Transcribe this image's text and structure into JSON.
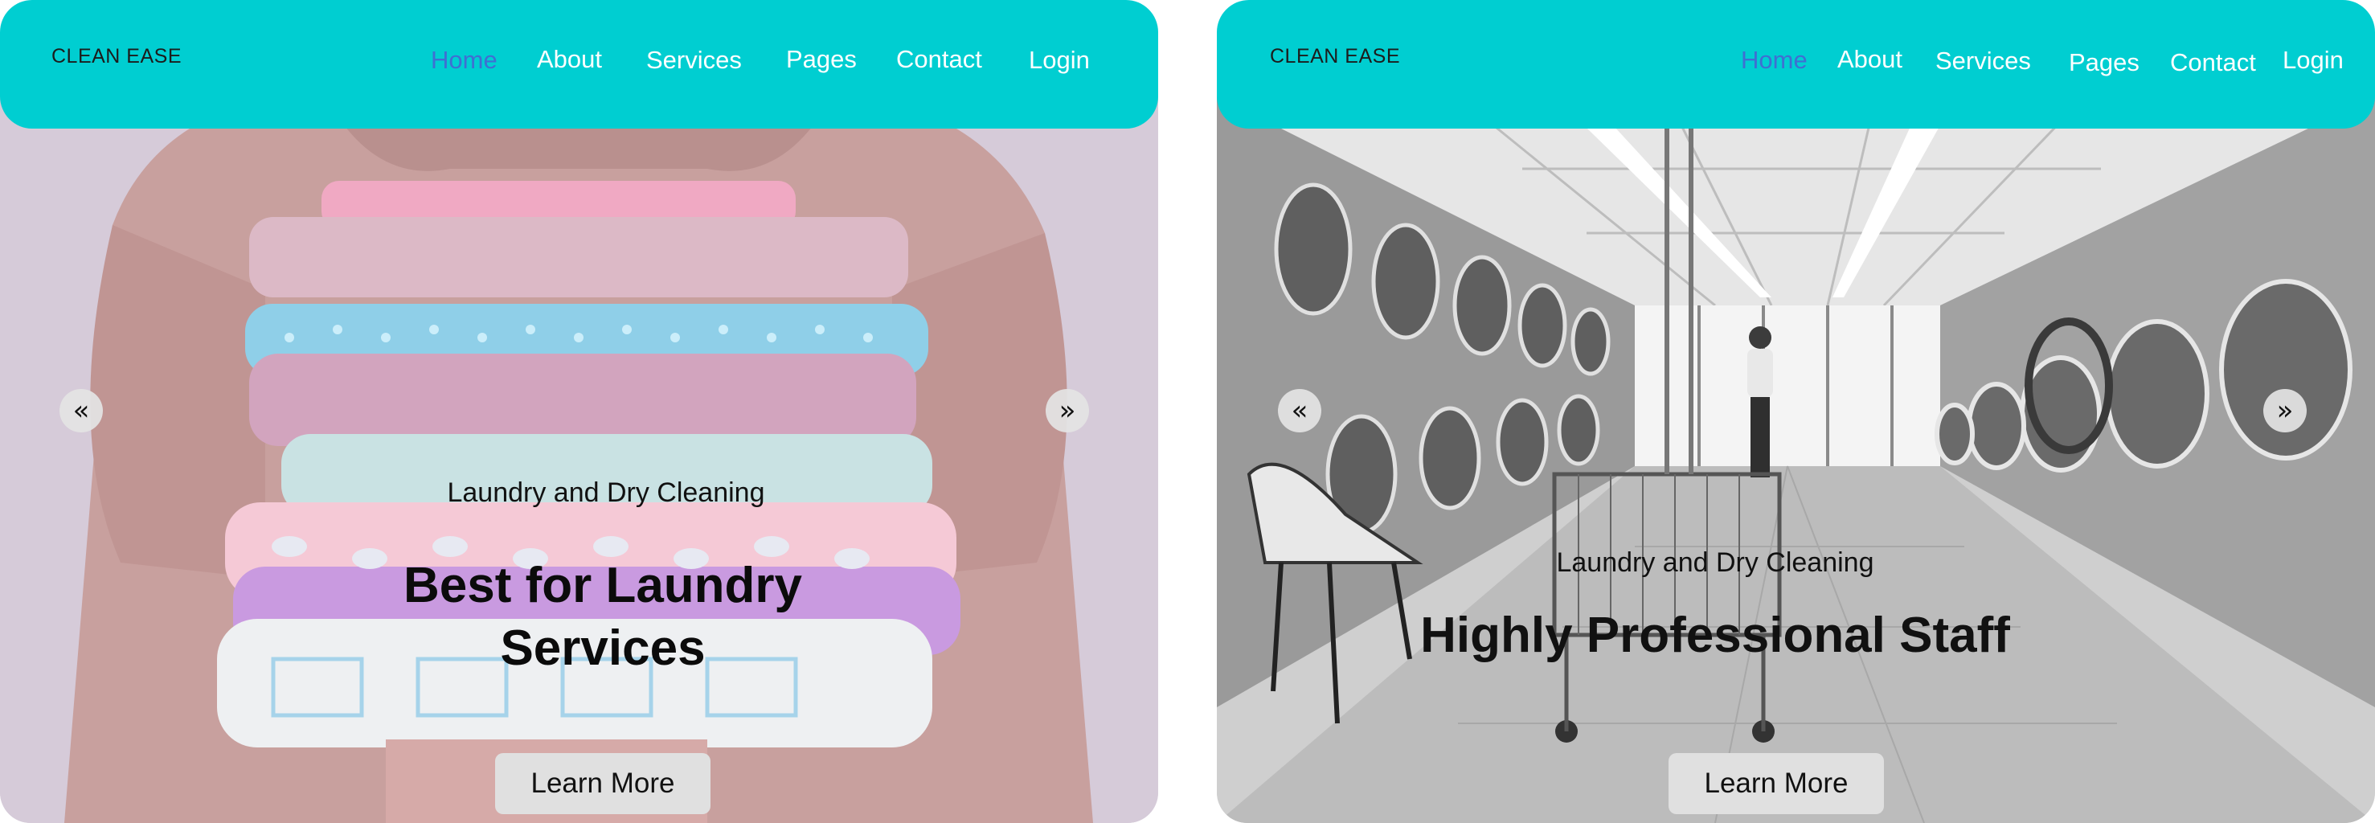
{
  "slides": [
    {
      "brand": "CLEAN EASE",
      "nav": [
        "Home",
        "About",
        "Services",
        "Pages",
        "Contact",
        "Login"
      ],
      "active_nav": "Home",
      "subtitle": "Laundry and Dry Cleaning",
      "title": "Best for Laundry Services",
      "cta": "Learn More",
      "prev_icon": "«",
      "next_icon": "»",
      "photo": "person-holding-stack-of-folded-laundry"
    },
    {
      "brand": "CLEAN EASE",
      "nav": [
        "Home",
        "About",
        "Services",
        "Pages",
        "Contact",
        "Login"
      ],
      "active_nav": "Home",
      "subtitle": "Laundry and Dry Cleaning",
      "title": "Highly Professional Staff",
      "cta": "Learn More",
      "prev_icon": "«",
      "next_icon": "»",
      "photo": "laundromat-interior-black-and-white"
    }
  ],
  "colors": {
    "navbar": "#00ced1",
    "nav_text": "#ffffff",
    "nav_active": "#3f6fd2",
    "button_bg": "#e0e0e0"
  }
}
